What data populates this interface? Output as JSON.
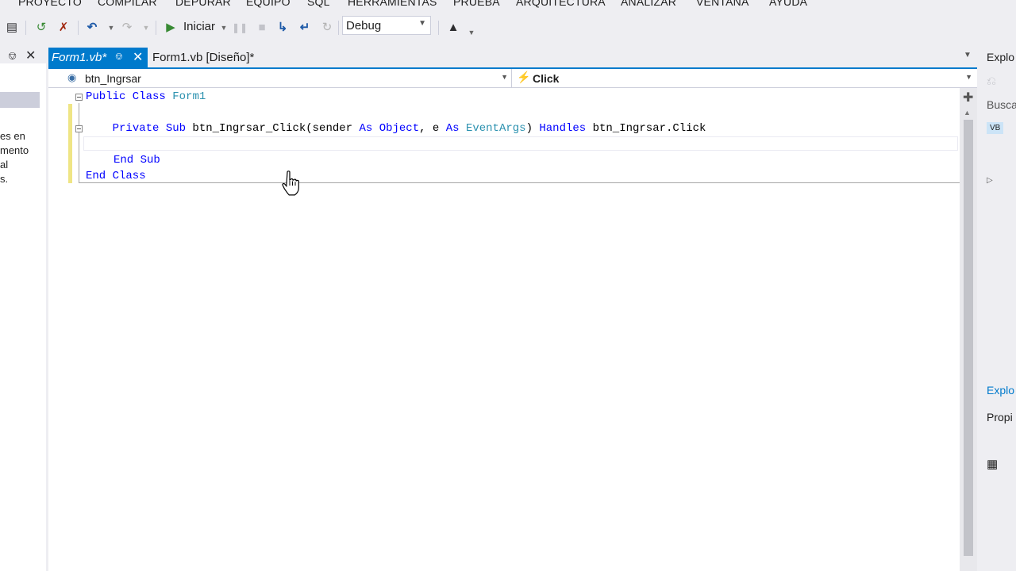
{
  "menu": [
    "PROYECTO",
    "COMPILAR",
    "DEPURAR",
    "EQUIPO",
    "SQL",
    "HERRAMIENTAS",
    "PRUEBA",
    "ARQUITECTURA",
    "ANALIZAR",
    "VENTANA",
    "AYUDA"
  ],
  "toolbar": {
    "start_label": "Iniciar",
    "config_value": "Debug",
    "icons": [
      "save-all-icon",
      "attach-icon",
      "detach-icon",
      "undo-icon",
      "redo-icon",
      "start-icon",
      "pause-icon",
      "stop-icon",
      "step-over-icon",
      "step-into-icon",
      "restart-icon",
      "publish-icon"
    ]
  },
  "left_panel": {
    "text_fragments": [
      "es en",
      "mento",
      "al",
      "s."
    ]
  },
  "tabs": [
    {
      "label": "Form1.vb*",
      "active": true
    },
    {
      "label": "Form1.vb [Diseño]*",
      "active": false
    }
  ],
  "navbar": {
    "object": "btn_Ingrsar",
    "event": "Click"
  },
  "code": {
    "line1": {
      "kw": "Public Class",
      "name": "Form1"
    },
    "line3": {
      "indent": "    ",
      "kw1": "Private Sub",
      "sig": " btn_Ingrsar_Click(sender ",
      "as1": "As",
      "sp1": " ",
      "obj": "Object",
      "mid": ", e ",
      "as2": "As",
      "sp2": " ",
      "ty": "EventArgs",
      "close": ") ",
      "handles": "Handles",
      "target": " btn_Ingrsar.Click"
    },
    "line5": "End Sub",
    "line6": "End Class"
  },
  "right_panel": {
    "fragments": [
      "Explo",
      "Busca",
      "Explo",
      "Propi"
    ]
  },
  "colors": {
    "accent": "#007acc",
    "keyword": "#0000ff",
    "type": "#2b91af"
  }
}
